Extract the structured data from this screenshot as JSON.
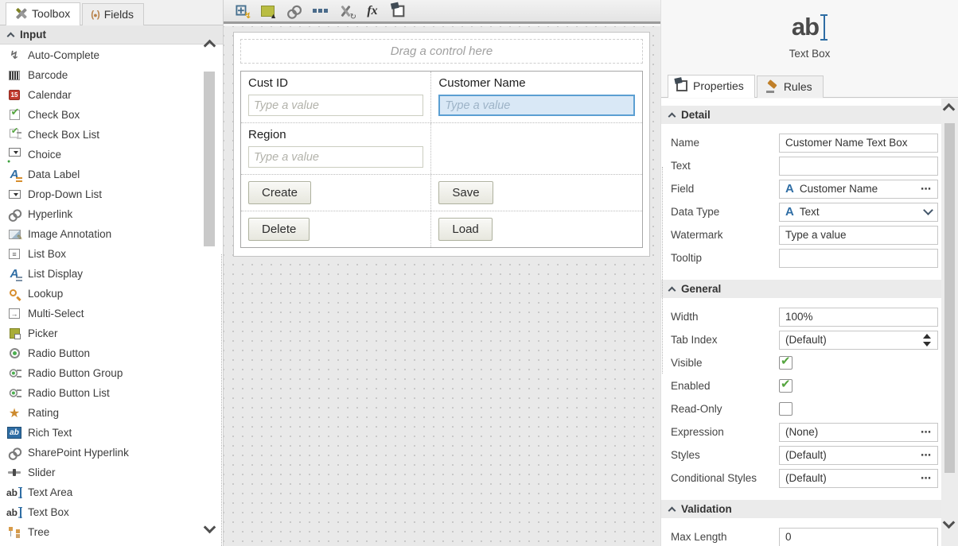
{
  "colors": {
    "accent_blue": "#5b9fd2",
    "selected_input_bg": "#d9e8f6",
    "field_icon_blue": "#2e6da4",
    "check_green": "#55a53f",
    "star_orange": "#cd8a2e",
    "calendar_red": "#c23b2e"
  },
  "left_panel": {
    "tabs": [
      {
        "label": "Toolbox",
        "icon": "toolbox-tools-icon",
        "active": true
      },
      {
        "label": "Fields",
        "icon": "fields-icon",
        "active": false
      }
    ],
    "section_label": "Input",
    "items": [
      {
        "label": "Auto-Complete",
        "icon": "bolt"
      },
      {
        "label": "Barcode",
        "icon": "barcode"
      },
      {
        "label": "Calendar",
        "icon": "calendar"
      },
      {
        "label": "Check Box",
        "icon": "checkbox"
      },
      {
        "label": "Check Box List",
        "icon": "checkboxlist"
      },
      {
        "label": "Choice",
        "icon": "choice"
      },
      {
        "label": "Data Label",
        "icon": "datalabel"
      },
      {
        "label": "Drop-Down List",
        "icon": "dropdownlist"
      },
      {
        "label": "Hyperlink",
        "icon": "link"
      },
      {
        "label": "Image Annotation",
        "icon": "image"
      },
      {
        "label": "List Box",
        "icon": "listbox"
      },
      {
        "label": "List Display",
        "icon": "listdisplay"
      },
      {
        "label": "Lookup",
        "icon": "lookup"
      },
      {
        "label": "Multi-Select",
        "icon": "multiselect"
      },
      {
        "label": "Picker",
        "icon": "picker"
      },
      {
        "label": "Radio Button",
        "icon": "radio"
      },
      {
        "label": "Radio Button Group",
        "icon": "radiogroup"
      },
      {
        "label": "Radio Button List",
        "icon": "radiolist"
      },
      {
        "label": "Rating",
        "icon": "star"
      },
      {
        "label": "Rich Text",
        "icon": "richtext"
      },
      {
        "label": "SharePoint Hyperlink",
        "icon": "link"
      },
      {
        "label": "Slider",
        "icon": "slider"
      },
      {
        "label": "Text Area",
        "icon": "abcursor"
      },
      {
        "label": "Text Box",
        "icon": "abcursor"
      },
      {
        "label": "Tree",
        "icon": "tree"
      }
    ]
  },
  "toolbar": {
    "icons": [
      "table-lightning",
      "form-export",
      "unlink",
      "ellipsis",
      "tools-refresh",
      "expression-fx",
      "paste-tag"
    ]
  },
  "canvas": {
    "drop_hint": "Drag a control here",
    "rows": [
      {
        "cells": [
          {
            "type": "field",
            "label": "Cust ID",
            "placeholder": "Type a value"
          },
          {
            "type": "field",
            "label": "Customer Name",
            "placeholder": "Type a value",
            "selected": true
          }
        ]
      },
      {
        "cells": [
          {
            "type": "field",
            "label": "Region",
            "placeholder": "Type a value"
          },
          {
            "type": "empty"
          }
        ]
      },
      {
        "cells": [
          {
            "type": "button",
            "label": "Create"
          },
          {
            "type": "button",
            "label": "Save"
          }
        ]
      },
      {
        "cells": [
          {
            "type": "button",
            "label": "Delete"
          },
          {
            "type": "button",
            "label": "Load"
          }
        ]
      }
    ]
  },
  "right_panel": {
    "control_icon": "ab",
    "control_type": "Text Box",
    "tabs": [
      {
        "label": "Properties",
        "icon": "properties-tag-icon",
        "active": true
      },
      {
        "label": "Rules",
        "icon": "rules-gavel-icon",
        "active": false
      }
    ],
    "sections": [
      {
        "title": "Detail",
        "rows": [
          {
            "label": "Name",
            "type": "text",
            "value": "Customer Name Text Box"
          },
          {
            "label": "Text",
            "type": "text",
            "value": ""
          },
          {
            "label": "Field",
            "type": "picker",
            "value": "Customer Name",
            "icon": "field-a"
          },
          {
            "label": "Data Type",
            "type": "dropdown",
            "value": "Text",
            "icon": "field-a"
          },
          {
            "label": "Watermark",
            "type": "text",
            "value": "Type a value"
          },
          {
            "label": "Tooltip",
            "type": "text",
            "value": ""
          }
        ]
      },
      {
        "title": "General",
        "rows": [
          {
            "label": "Width",
            "type": "text",
            "value": "100%"
          },
          {
            "label": "Tab Index",
            "type": "spinner",
            "value": "(Default)"
          },
          {
            "label": "Visible",
            "type": "checkbox",
            "checked": true
          },
          {
            "label": "Enabled",
            "type": "checkbox",
            "checked": true
          },
          {
            "label": "Read-Only",
            "type": "checkbox",
            "checked": false
          },
          {
            "label": "Expression",
            "type": "picker",
            "value": "(None)"
          },
          {
            "label": "Styles",
            "type": "picker",
            "value": "(Default)"
          },
          {
            "label": "Conditional Styles",
            "type": "picker",
            "value": "(Default)"
          }
        ]
      },
      {
        "title": "Validation",
        "rows": [
          {
            "label": "Max Length",
            "type": "text",
            "value": "0"
          }
        ]
      }
    ]
  }
}
